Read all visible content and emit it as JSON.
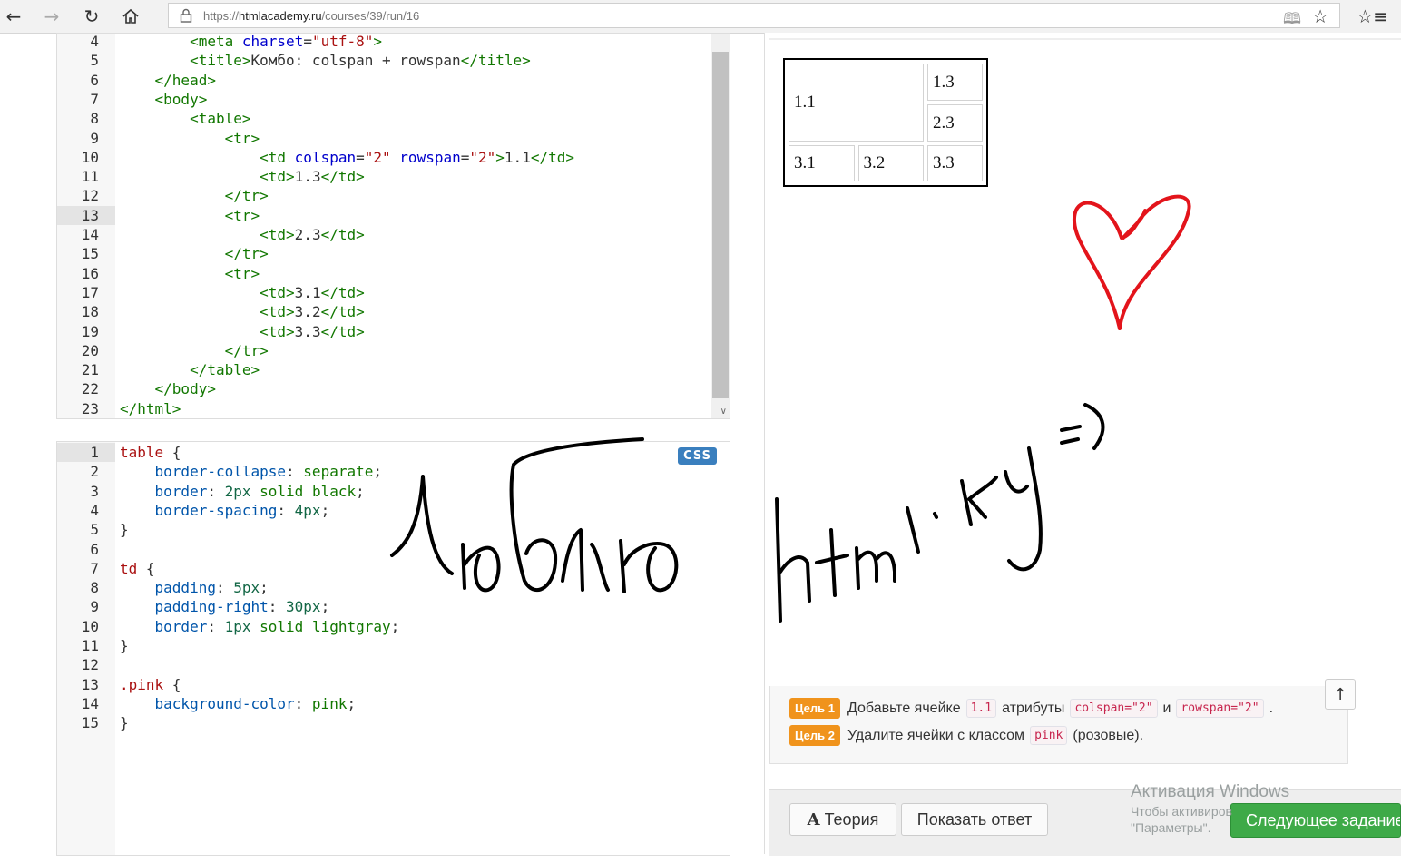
{
  "browser": {
    "url_prefix": "https://",
    "url_host": "htmlacademy.ru",
    "url_path": "/courses/39/run/16",
    "icons": [
      "back-icon",
      "forward-icon",
      "refresh-icon",
      "home-icon",
      "lock-icon",
      "reading-view-icon",
      "favorite-star-icon",
      "favorites-hub-icon"
    ]
  },
  "html_editor": {
    "active_line": "13",
    "lines": [
      {
        "n": "4",
        "code": "        <meta charset=\"utf-8\">"
      },
      {
        "n": "5",
        "code": "        <title>Комбо: colspan + rowspan</title>"
      },
      {
        "n": "6",
        "code": "    </head>"
      },
      {
        "n": "7",
        "code": "    <body>"
      },
      {
        "n": "8",
        "code": "        <table>"
      },
      {
        "n": "9",
        "code": "            <tr>"
      },
      {
        "n": "10",
        "code": "                <td colspan=\"2\" rowspan=\"2\">1.1</td>"
      },
      {
        "n": "11",
        "code": "                <td>1.3</td>"
      },
      {
        "n": "12",
        "code": "            </tr>"
      },
      {
        "n": "13",
        "code": "            <tr>"
      },
      {
        "n": "14",
        "code": "                <td>2.3</td>"
      },
      {
        "n": "15",
        "code": "            </tr>"
      },
      {
        "n": "16",
        "code": "            <tr>"
      },
      {
        "n": "17",
        "code": "                <td>3.1</td>"
      },
      {
        "n": "18",
        "code": "                <td>3.2</td>"
      },
      {
        "n": "19",
        "code": "                <td>3.3</td>"
      },
      {
        "n": "20",
        "code": "            </tr>"
      },
      {
        "n": "21",
        "code": "        </table>"
      },
      {
        "n": "22",
        "code": "    </body>"
      },
      {
        "n": "23",
        "code": "</html>"
      }
    ]
  },
  "css_editor": {
    "badge": "CSS",
    "active_line": "1",
    "lines": [
      {
        "n": "1",
        "code": "table {"
      },
      {
        "n": "2",
        "code": "    border-collapse: separate;"
      },
      {
        "n": "3",
        "code": "    border: 2px solid black;"
      },
      {
        "n": "4",
        "code": "    border-spacing: 4px;"
      },
      {
        "n": "5",
        "code": "}"
      },
      {
        "n": "6",
        "code": ""
      },
      {
        "n": "7",
        "code": "td {"
      },
      {
        "n": "8",
        "code": "    padding: 5px;"
      },
      {
        "n": "9",
        "code": "    padding-right: 30px;"
      },
      {
        "n": "10",
        "code": "    border: 1px solid lightgray;"
      },
      {
        "n": "11",
        "code": "}"
      },
      {
        "n": "12",
        "code": ""
      },
      {
        "n": "13",
        "code": ".pink {"
      },
      {
        "n": "14",
        "code": "    background-color: pink;"
      },
      {
        "n": "15",
        "code": "}"
      }
    ]
  },
  "preview": {
    "cells": {
      "c11": "1.1",
      "c13": "1.3",
      "c23": "2.3",
      "c31": "3.1",
      "c32": "3.2",
      "c33": "3.3"
    },
    "heart_color": "#e3141b"
  },
  "tasks": [
    {
      "badge": "Цель 1",
      "parts": [
        "Добавьте ячейке",
        "1.1",
        "атрибуты",
        "colspan=\"2\"",
        "и",
        "rowspan=\"2\"",
        "."
      ]
    },
    {
      "badge": "Цель 2",
      "parts": [
        "Удалите ячейки с классом",
        "pink",
        "(розовые)."
      ]
    }
  ],
  "buttons": {
    "theory": "Теория",
    "theory_icon": "A",
    "show_answer": "Показать ответ",
    "next_task": "Следующее задание",
    "scroll_up": "↑"
  },
  "watermark": {
    "title": "Активация Windows",
    "line1": "Чтобы активиров",
    "line2": "\"Параметры\"."
  },
  "colors": {
    "accent_orange": "#f0931c",
    "next_green": "#3eaa48",
    "css_badge": "#3a7fbe"
  }
}
